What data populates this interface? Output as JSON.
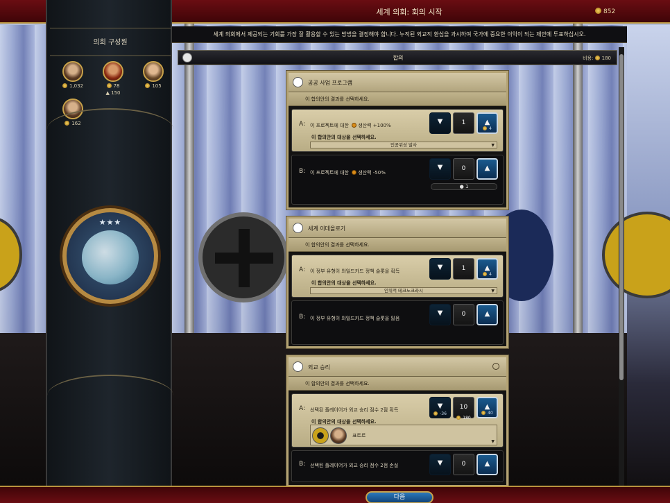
{
  "window": {
    "title": "세계 의회: 회의 시작",
    "gold": "852"
  },
  "left_panel": {
    "title": "의회 구성원",
    "members": [
      {
        "stat1": "1,032",
        "stat2": ""
      },
      {
        "stat1": "78",
        "stat2": "150"
      },
      {
        "stat1": "105",
        "stat2": ""
      },
      {
        "stat1": "162",
        "stat2": ""
      }
    ]
  },
  "header": {
    "instruction": "세계 의회에서 제공되는 기회를 가장 잘 활용할 수 있는 방법을 결정해야 합니다. 누적된  외교적 환심을 과시하여 국가에 중요한 이익이 되는 제안에 투표하십시오."
  },
  "agenda": {
    "title": "합의",
    "cost_label": "비용:",
    "cost": "180"
  },
  "cards": [
    {
      "title": "공공 사업 프로그램",
      "subtitle": "이 합의안의 결과를 선택하세요.",
      "option_a": {
        "letter": "A:",
        "text_prefix": "이 프로젝트에 대한",
        "text_suffix": "생산력 +100%",
        "target_label": "이 합의안의 대상을 선택하세요.",
        "target": "인공위성 발사",
        "down_icon": "thumbs-down",
        "count": "1",
        "up_icon": "thumbs-up",
        "up_sub": "4"
      },
      "option_b": {
        "letter": "B:",
        "text_prefix": "이 프로젝트에 대한",
        "text_suffix": "생산력 -50%",
        "count": "0",
        "bar_count": "1"
      }
    },
    {
      "title": "세계 이데올로기",
      "subtitle": "이 합의안의 결과를 선택하세요.",
      "option_a": {
        "letter": "A:",
        "text": "이 정부 유형이 와일드카드 정책 슬롯을 획득",
        "target_label": "이 합의안의 대상을 선택하세요.",
        "target": "인위적 테크노크라시",
        "count": "1",
        "up_sub": "4"
      },
      "option_b": {
        "letter": "B:",
        "text": "이 정부 유형이 와일드카드 정책 슬롯을 잃음",
        "count": "0"
      }
    },
    {
      "title": "외교 승리",
      "subtitle": "이 합의안의 결과를 선택하세요.",
      "option_a": {
        "letter": "A:",
        "text": "선택된 플레이어가 외교 승리 점수 2점 획득",
        "target_label": "이 합의안의 대상을 선택하세요.",
        "target": "표트르",
        "down_sub": "-36",
        "count": "10",
        "count_sub": "180",
        "up_sub": "40"
      },
      "option_b": {
        "letter": "B:",
        "text": "선택된 플레이어가 외교 승리 점수 2점 손실",
        "count": "0"
      }
    }
  ],
  "footer": {
    "next_label": "다음"
  },
  "colors": {
    "accent_gold": "#b8933e",
    "top_bar": "#6a0d12",
    "vote_up": "#1a5a8e"
  }
}
